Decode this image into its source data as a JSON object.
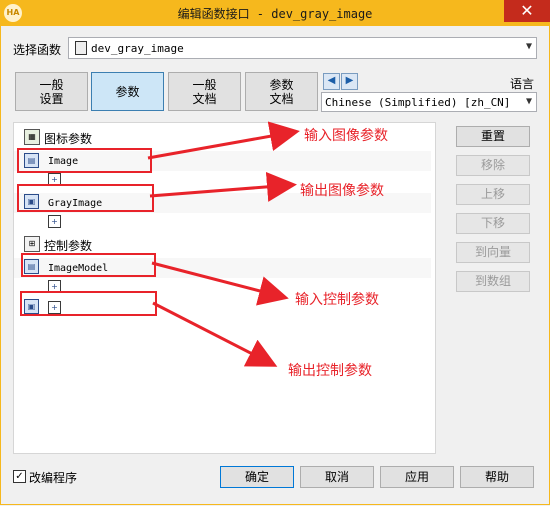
{
  "window": {
    "title": "编辑函数接口 - dev_gray_image",
    "close_label": "✕",
    "app_icon": "HA"
  },
  "procedure": {
    "label": "选择函数",
    "value": "dev_gray_image"
  },
  "tabs": [
    {
      "line1": "一般",
      "line2": "设置"
    },
    {
      "line1": "参数",
      "line2": ""
    },
    {
      "line1": "一般",
      "line2": "文档"
    },
    {
      "line1": "参数",
      "line2": "文档"
    }
  ],
  "language": {
    "label": "语言",
    "value": "Chinese (Simplified) [zh_CN]"
  },
  "params": {
    "icon_group": "图标参数",
    "control_group": "控制参数",
    "image_in": "Image",
    "image_out": "GrayImage",
    "control_in": "ImageModel"
  },
  "annotations": {
    "input_image": "输入图像参数",
    "output_image": "输出图像参数",
    "input_control": "输入控制参数",
    "output_control": "输出控制参数",
    "color": "#e8232a"
  },
  "side_buttons": [
    "重置",
    "移除",
    "上移",
    "下移",
    "到向量",
    "到数组"
  ],
  "footer": {
    "checkbox_label": "改编程序",
    "check_mark": "✓",
    "buttons": [
      "确定",
      "取消",
      "应用",
      "帮助"
    ]
  },
  "icons": {
    "procedure": "procedure-icon",
    "prev": "arrow-left-icon",
    "next": "arrow-right-icon",
    "dropdown": "chevron-down-icon"
  }
}
